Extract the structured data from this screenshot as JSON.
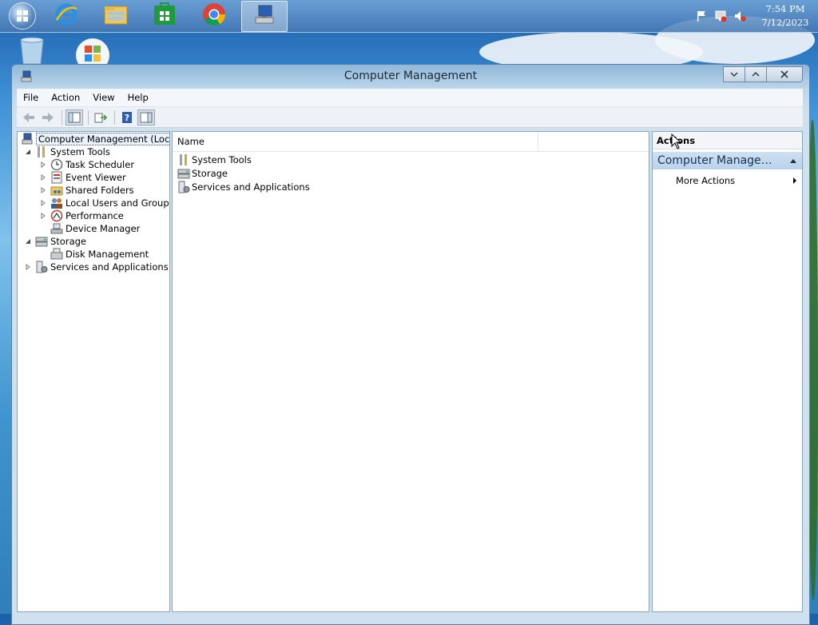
{
  "taskbar": {
    "apps": [
      {
        "name": "Internet Explorer",
        "icon": "internet-explorer-icon"
      },
      {
        "name": "File Explorer",
        "icon": "file-explorer-icon"
      },
      {
        "name": "Store",
        "icon": "store-icon"
      },
      {
        "name": "Google Chrome",
        "icon": "chrome-icon"
      },
      {
        "name": "Computer Management",
        "icon": "computer-management-icon",
        "active": true
      }
    ],
    "clock": {
      "time": "7:54 PM",
      "date": "7/12/2023"
    }
  },
  "window": {
    "title": "Computer Management",
    "menu": [
      "File",
      "Action",
      "View",
      "Help"
    ]
  },
  "tree": {
    "root": "Computer Management (Local)",
    "system_tools": "System Tools",
    "task_scheduler": "Task Scheduler",
    "event_viewer": "Event Viewer",
    "shared_folders": "Shared Folders",
    "local_users": "Local Users and Groups",
    "performance": "Performance",
    "device_manager": "Device Manager",
    "storage": "Storage",
    "disk_management": "Disk Management",
    "services": "Services and Applications"
  },
  "list": {
    "column_name": "Name",
    "rows": [
      "System Tools",
      "Storage",
      "Services and Applications"
    ]
  },
  "actions": {
    "header": "Actions",
    "section": "Computer Manageme...",
    "more_actions": "More Actions"
  },
  "colors": {
    "taskbar": "#5a8cc8",
    "window_frame": "#cfe0ef",
    "selection_bg": "#eaf3fc",
    "actions_section": "#c3d8ee"
  }
}
